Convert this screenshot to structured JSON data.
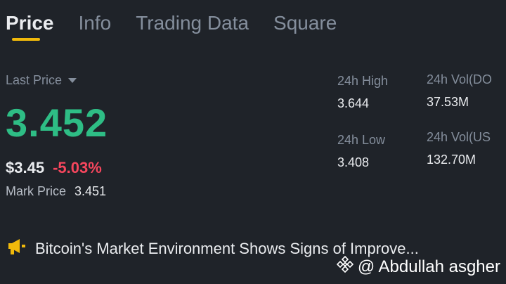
{
  "tabs": [
    {
      "label": "Price",
      "active": true
    },
    {
      "label": "Info",
      "active": false
    },
    {
      "label": "Trading Data",
      "active": false
    },
    {
      "label": "Square",
      "active": false
    }
  ],
  "price": {
    "last_price_label": "Last Price",
    "last_price": "3.452",
    "fiat_price": "$3.45",
    "change_percent": "-5.03%",
    "mark_price_label": "Mark Price",
    "mark_price": "3.451"
  },
  "stats": {
    "high_label": "24h High",
    "high_value": "3.644",
    "low_label": "24h Low",
    "low_value": "3.408",
    "vol1_label": "24h Vol(DO",
    "vol1_value": "37.53M",
    "vol2_label": "24h Vol(US",
    "vol2_value": "132.70M"
  },
  "news": {
    "headline": "Bitcoin's Market Environment Shows Signs of Improve...",
    "icon": "megaphone-icon"
  },
  "watermark": {
    "text": "@ Abdullah asgher",
    "icon": "binance-logo-icon"
  },
  "colors": {
    "background": "#1f2329",
    "accent": "#f0b90b",
    "up": "#2ebd85",
    "down": "#f6465d",
    "muted": "#848e9c",
    "text": "#eaecef"
  }
}
